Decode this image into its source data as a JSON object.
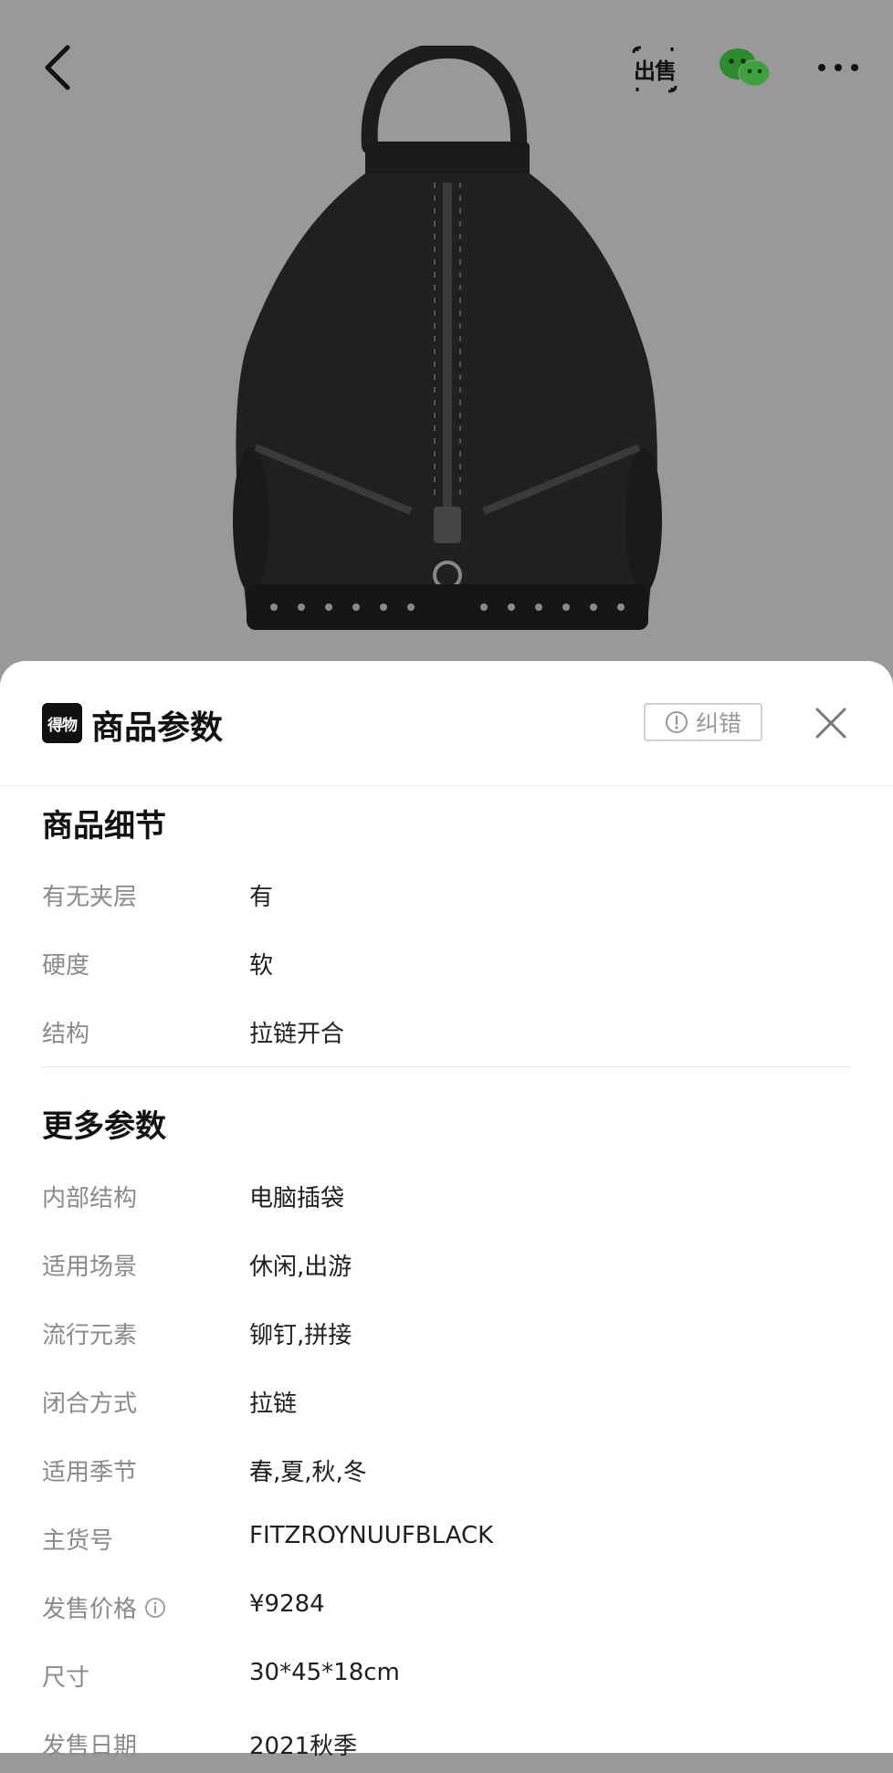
{
  "topbar": {
    "sell_label": "出售"
  },
  "sheet": {
    "title": "商品参数",
    "brand_logo_text": "得物",
    "report_label": "纠错"
  },
  "details": {
    "title": "商品细节",
    "rows": [
      {
        "k": "有无夹层",
        "v": "有"
      },
      {
        "k": "硬度",
        "v": "软"
      },
      {
        "k": "结构",
        "v": "拉链开合"
      }
    ]
  },
  "more": {
    "title": "更多参数",
    "rows": [
      {
        "k": "内部结构",
        "v": "电脑插袋"
      },
      {
        "k": "适用场景",
        "v": "休闲,出游"
      },
      {
        "k": "流行元素",
        "v": "铆钉,拼接"
      },
      {
        "k": "闭合方式",
        "v": "拉链"
      },
      {
        "k": "适用季节",
        "v": "春,夏,秋,冬"
      },
      {
        "k": "主货号",
        "v": "FITZROYNUUFBLACK"
      },
      {
        "k": "发售价格",
        "v": "¥9284"
      },
      {
        "k": "尺寸",
        "v": "30*45*18cm"
      },
      {
        "k": "发售日期",
        "v": "2021秋季"
      }
    ]
  },
  "icons": {
    "back": "back-arrow-icon",
    "wechat": "wechat-icon",
    "more": "more-icon",
    "close": "close-icon",
    "report": "exclamation-circle-icon",
    "info": "info-icon"
  }
}
